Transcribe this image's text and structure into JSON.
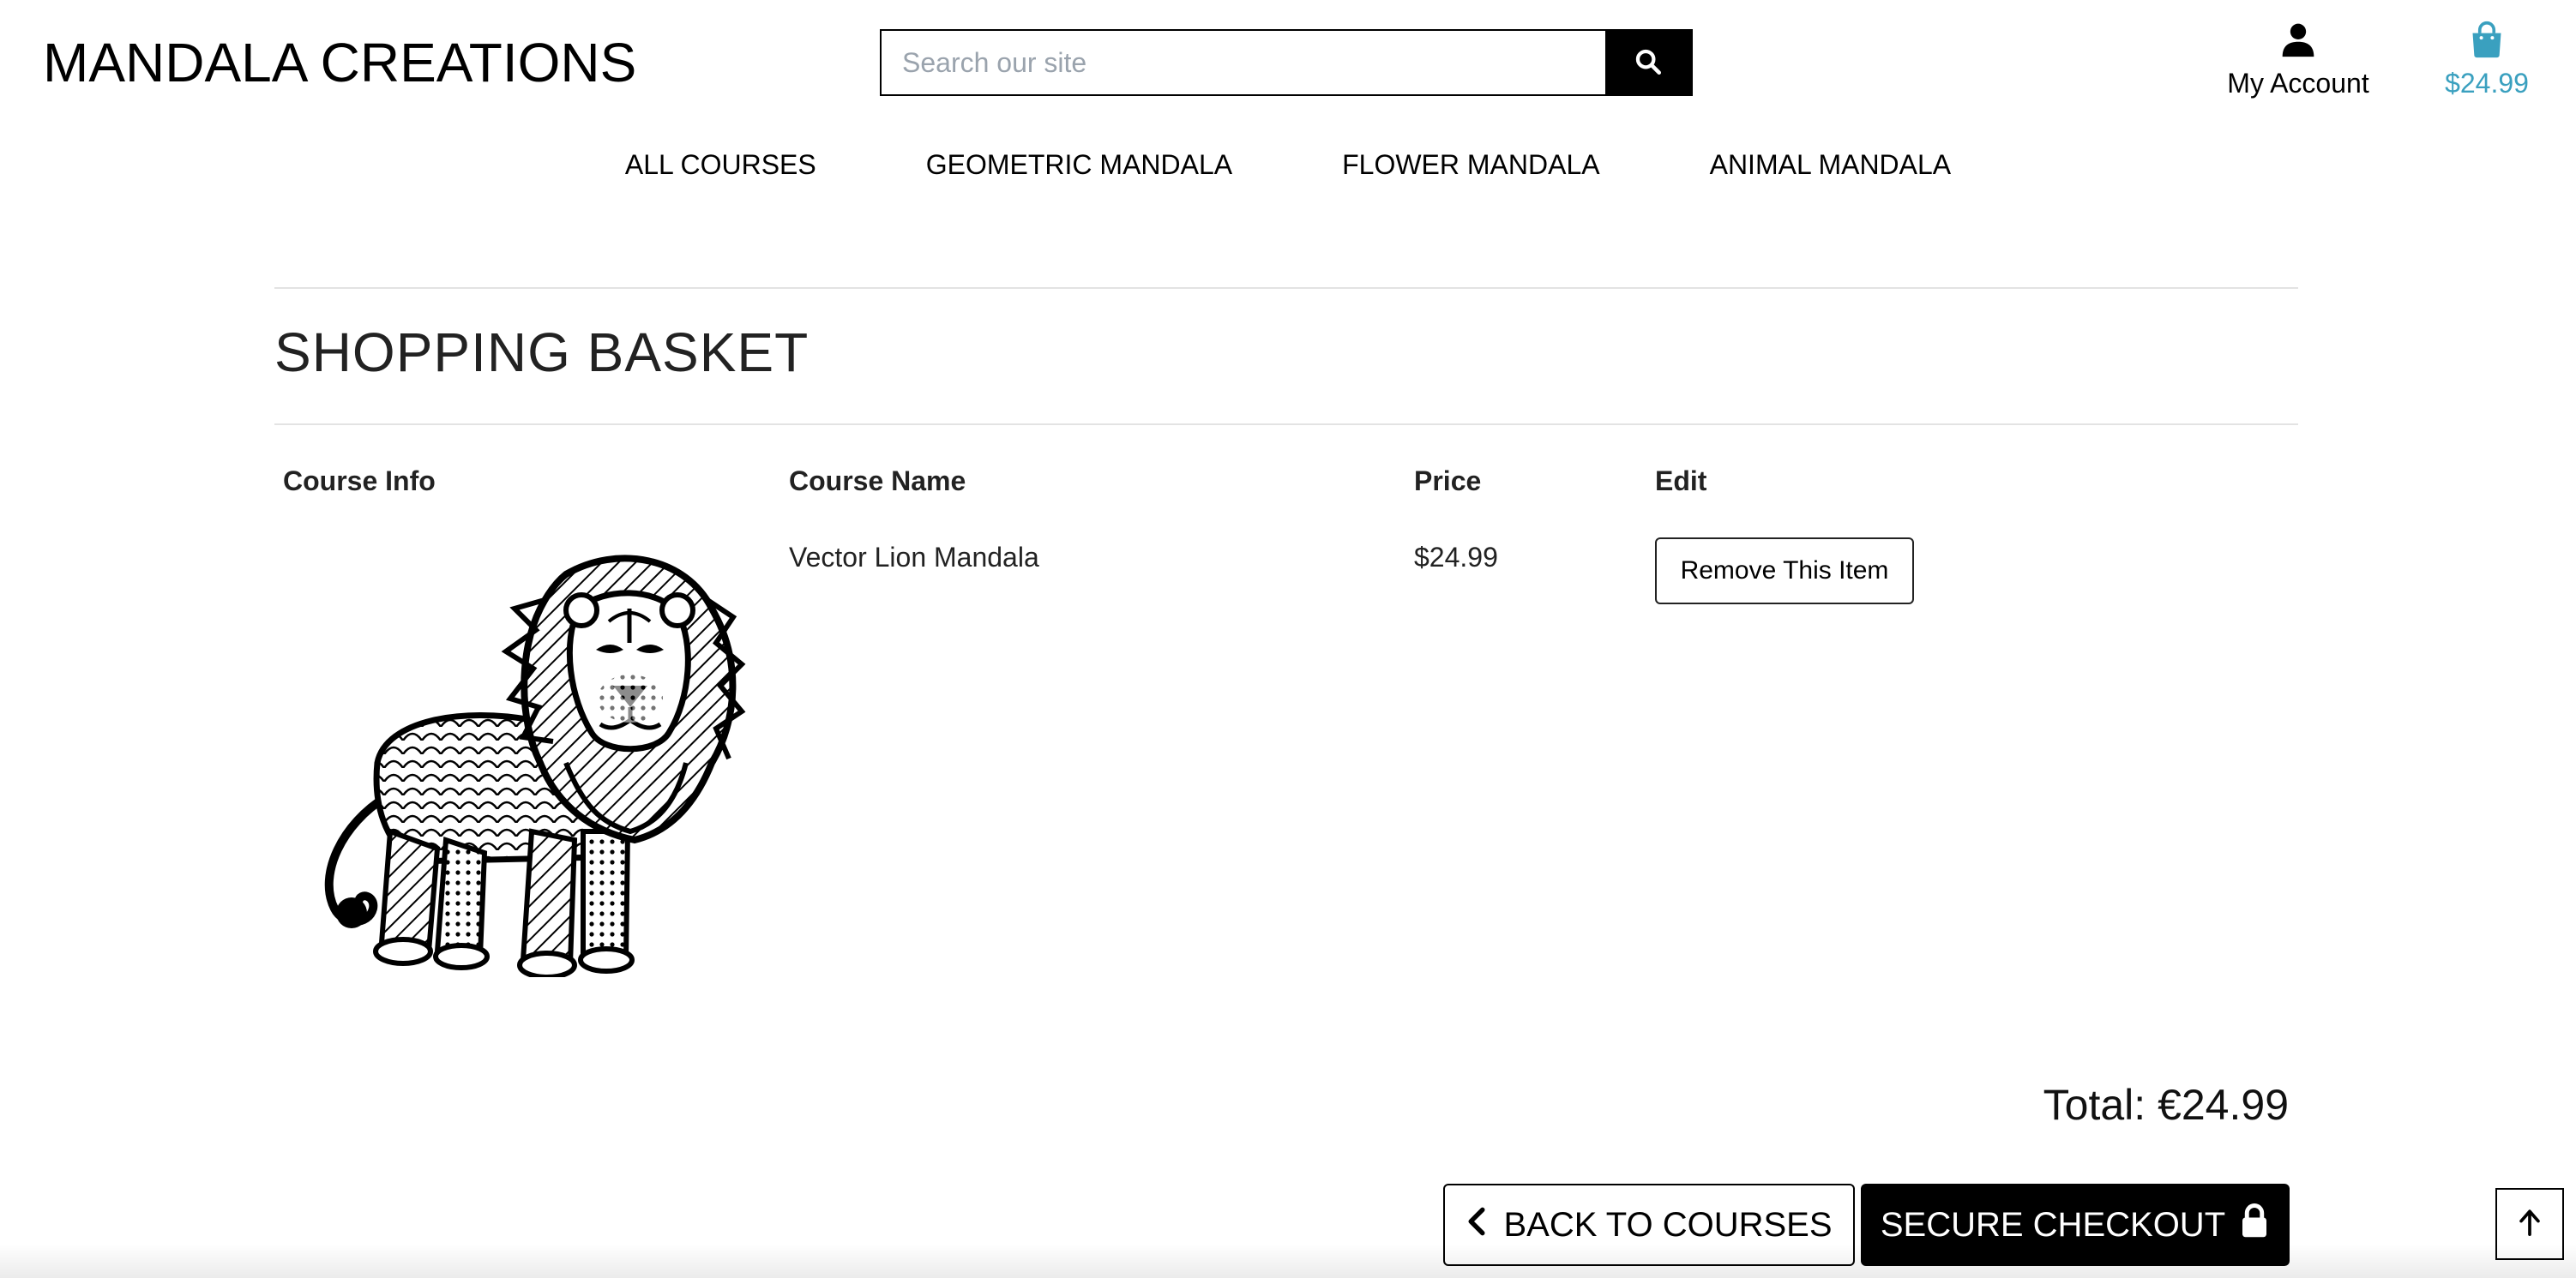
{
  "brand": {
    "logo_text": "MANDALA CREATIONS",
    "accent_color": "#3aa0bf"
  },
  "search": {
    "placeholder": "Search our site",
    "value": "",
    "icon": "search-icon"
  },
  "header": {
    "account_label": "My Account",
    "account_icon": "user-icon",
    "basket_total": "$24.99",
    "basket_icon": "shopping-bag-icon"
  },
  "nav": {
    "items": [
      {
        "label": "ALL COURSES"
      },
      {
        "label": "GEOMETRIC MANDALA"
      },
      {
        "label": "FLOWER MANDALA"
      },
      {
        "label": "ANIMAL MANDALA"
      }
    ]
  },
  "page": {
    "title": "SHOPPING BASKET"
  },
  "table": {
    "headers": [
      "Course Info",
      "Course Name",
      "Price",
      "Edit"
    ],
    "rows": [
      {
        "image": "lion-mandala-image",
        "name": "Vector Lion Mandala",
        "price": "$24.99",
        "action": "Remove This Item"
      }
    ]
  },
  "summary": {
    "total": "Total: €24.99"
  },
  "actions": {
    "back_label": "BACK TO COURSES",
    "back_icon": "chevron-left-icon",
    "checkout_label": "SECURE CHECKOUT",
    "checkout_icon": "lock-icon",
    "back_to_top_icon": "arrow-up-icon"
  }
}
